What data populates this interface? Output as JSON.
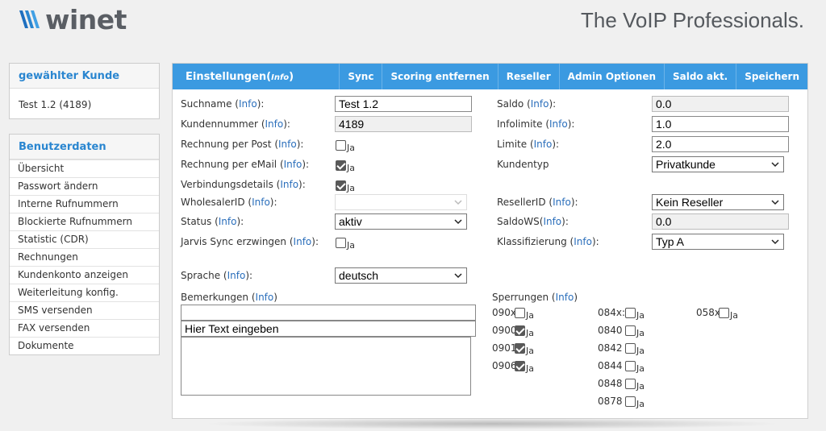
{
  "header": {
    "logo_text": "winet",
    "tagline": "The VoIP Professionals."
  },
  "customer_panel": {
    "title": "gewählter Kunde",
    "value": "Test 1.2 (4189)"
  },
  "user_panel": {
    "title": "Benutzerdaten",
    "items": [
      "Übersicht",
      "Passwort ändern",
      "Interne Rufnummern",
      "Blockierte Rufnummern",
      "Statistic (CDR)",
      "Rechnungen",
      "Kundenkonto anzeigen",
      "Weiterleitung konfig.",
      "SMS versenden",
      "FAX versenden",
      "Dokumente"
    ]
  },
  "toolbar": {
    "title": "Einstellungen(",
    "title_info": "Info",
    "title_close": ")",
    "buttons": [
      "Sync",
      "Scoring entfernen",
      "Reseller",
      "Admin Optionen",
      "Saldo akt.",
      "Speichern"
    ]
  },
  "info": "Info",
  "ja": "Ja",
  "fields": {
    "suchname": {
      "label": "Suchname",
      "value": "Test 1.2"
    },
    "kundennummer": {
      "label": "Kundennummer",
      "value": "4189"
    },
    "post": {
      "label": "Rechnung per Post",
      "checked": false
    },
    "email": {
      "label": "Rechnung per eMail",
      "checked": true
    },
    "verbindung": {
      "label": "Verbindungsdetails",
      "checked": true
    },
    "wholesaler": {
      "label": "WholesalerID",
      "value": ""
    },
    "status": {
      "label": "Status",
      "value": "aktiv"
    },
    "jarvis": {
      "label": "Jarvis Sync erzwingen",
      "checked": false
    },
    "sprache": {
      "label": "Sprache",
      "value": "deutsch"
    },
    "saldo": {
      "label": "Saldo",
      "value": "0.0"
    },
    "infolimite": {
      "label": "Infolimite",
      "value": "1.0"
    },
    "limite": {
      "label": "Limite",
      "value": "2.0"
    },
    "kundentyp": {
      "label": "Kundentyp",
      "value": "Privatkunde"
    },
    "reseller": {
      "label": "ResellerID",
      "value": "Kein Reseller"
    },
    "saldows": {
      "label": "SaldoWS",
      "value": "0.0"
    },
    "klass": {
      "label": "Klassifizierung",
      "value": "Typ A"
    }
  },
  "bemerkungen": {
    "label": "Bemerkungen",
    "line1": "",
    "line2": "Hier Text eingeben",
    "body": ""
  },
  "sperrungen": {
    "label": "Sperrungen",
    "col1": [
      {
        "code": "090x",
        "checked": false
      },
      {
        "code": "0900",
        "checked": true
      },
      {
        "code": "0901",
        "checked": true
      },
      {
        "code": "0906",
        "checked": true
      }
    ],
    "col2": [
      {
        "code": "084x:",
        "checked": false
      },
      {
        "code": "0840",
        "checked": false
      },
      {
        "code": "0842",
        "checked": false
      },
      {
        "code": "0844",
        "checked": false
      },
      {
        "code": "0848",
        "checked": false
      },
      {
        "code": "0878",
        "checked": false
      }
    ],
    "col3": [
      {
        "code": "058x",
        "checked": false
      }
    ]
  },
  "colors": {
    "accent": "#3b9ae1",
    "link": "#2a6ebb",
    "panel_title": "#2a86d0"
  }
}
